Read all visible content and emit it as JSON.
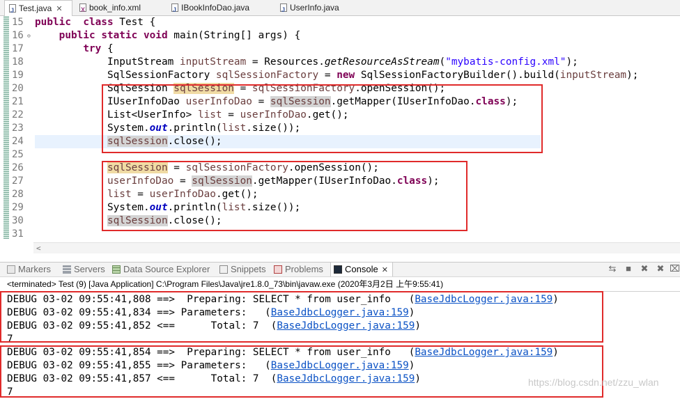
{
  "tabs": [
    {
      "label": "Test.java",
      "icon": "java-file-icon",
      "active": true,
      "close": "✕"
    },
    {
      "label": "book_info.xml",
      "icon": "xml-file-icon",
      "active": false
    },
    {
      "label": "IBookInfoDao.java",
      "icon": "java-file-icon",
      "active": false
    },
    {
      "label": "UserInfo.java",
      "icon": "java-file-icon",
      "active": false
    }
  ],
  "editor": {
    "line_numbers": [
      "15",
      "16",
      "17",
      "18",
      "19",
      "20",
      "21",
      "22",
      "23",
      "24",
      "25",
      "26",
      "27",
      "28",
      "29",
      "30",
      "31"
    ],
    "current_line": "24",
    "folds": {
      "16": "⊖"
    },
    "line_tokens": {
      "15": [
        [
          "kw",
          "public"
        ],
        [
          "",
          "  "
        ],
        [
          "kw",
          "class"
        ],
        [
          "",
          " Test {"
        ]
      ],
      "16": [
        [
          "",
          "    "
        ],
        [
          "kw",
          "public"
        ],
        [
          "",
          " "
        ],
        [
          "kw",
          "static"
        ],
        [
          "",
          " "
        ],
        [
          "kw",
          "void"
        ],
        [
          "",
          " main(String[] args) {"
        ]
      ],
      "17": [
        [
          "",
          "        "
        ],
        [
          "kw",
          "try"
        ],
        [
          "",
          " {"
        ]
      ],
      "18": [
        [
          "",
          "            InputStream "
        ],
        [
          "var",
          "inputStream"
        ],
        [
          "",
          " = Resources."
        ],
        [
          "sm",
          "getResourceAsStream"
        ],
        [
          "",
          "("
        ],
        [
          "str",
          "\"mybatis-config.xml\""
        ],
        [
          "",
          ");"
        ]
      ],
      "19": [
        [
          "",
          "            SqlSessionFactory "
        ],
        [
          "var",
          "sqlSessionFactory"
        ],
        [
          "",
          " = "
        ],
        [
          "kw",
          "new"
        ],
        [
          "",
          " SqlSessionFactoryBuilder().build("
        ],
        [
          "var",
          "inputStream"
        ],
        [
          "",
          ");"
        ]
      ],
      "20": [
        [
          "",
          "            SqlSession "
        ],
        [
          "var hl",
          "sqlSession"
        ],
        [
          "",
          " = "
        ],
        [
          "var",
          "sqlSessionFactory"
        ],
        [
          "",
          ".openSession();"
        ]
      ],
      "21": [
        [
          "",
          "            IUserInfoDao "
        ],
        [
          "var",
          "userInfoDao"
        ],
        [
          "",
          " = "
        ],
        [
          "var hlg",
          "sqlSession"
        ],
        [
          "",
          ".getMapper(IUserInfoDao."
        ],
        [
          "kw",
          "class"
        ],
        [
          "",
          ");"
        ]
      ],
      "22": [
        [
          "",
          "            List<UserInfo> "
        ],
        [
          "var",
          "list"
        ],
        [
          "",
          " = "
        ],
        [
          "var",
          "userInfoDao"
        ],
        [
          "",
          ".get();"
        ]
      ],
      "23": [
        [
          "",
          "            System."
        ],
        [
          "fld",
          "out"
        ],
        [
          "",
          ".println("
        ],
        [
          "var",
          "list"
        ],
        [
          "",
          ".size());"
        ]
      ],
      "24": [
        [
          "",
          "            "
        ],
        [
          "var hlg",
          "sqlSession"
        ],
        [
          "",
          ".close();"
        ]
      ],
      "25": [
        [
          "",
          ""
        ]
      ],
      "26": [
        [
          "",
          "            "
        ],
        [
          "var hl",
          "sqlSession"
        ],
        [
          "",
          " = "
        ],
        [
          "var",
          "sqlSessionFactory"
        ],
        [
          "",
          ".openSession();"
        ]
      ],
      "27": [
        [
          "",
          "            "
        ],
        [
          "var",
          "userInfoDao"
        ],
        [
          "",
          " = "
        ],
        [
          "var hlg",
          "sqlSession"
        ],
        [
          "",
          ".getMapper(IUserInfoDao."
        ],
        [
          "kw",
          "class"
        ],
        [
          "",
          ");"
        ]
      ],
      "28": [
        [
          "",
          "            "
        ],
        [
          "var",
          "list"
        ],
        [
          "",
          " = "
        ],
        [
          "var",
          "userInfoDao"
        ],
        [
          "",
          ".get();"
        ]
      ],
      "29": [
        [
          "",
          "            System."
        ],
        [
          "fld",
          "out"
        ],
        [
          "",
          ".println("
        ],
        [
          "var",
          "list"
        ],
        [
          "",
          ".size());"
        ]
      ],
      "30": [
        [
          "",
          "            "
        ],
        [
          "var hlg",
          "sqlSession"
        ],
        [
          "",
          ".close();"
        ]
      ],
      "31": [
        [
          "",
          ""
        ]
      ]
    },
    "scroll_arrow": "<"
  },
  "views": {
    "tabs": [
      {
        "label": "Markers",
        "icon": "markers-icon",
        "active": false
      },
      {
        "label": "Servers",
        "icon": "servers-icon",
        "active": false
      },
      {
        "label": "Data Source Explorer",
        "icon": "data-source-explorer-icon",
        "active": false
      },
      {
        "label": "Snippets",
        "icon": "snippets-icon",
        "active": false
      },
      {
        "label": "Problems",
        "icon": "problems-icon",
        "active": false
      },
      {
        "label": "Console",
        "icon": "console-icon",
        "active": true
      }
    ],
    "console_close": "✕",
    "toolbar_icons": [
      {
        "name": "link-icon",
        "glyph": "⇆"
      },
      {
        "name": "terminate-icon",
        "glyph": "■"
      },
      {
        "name": "remove-launch-icon",
        "glyph": "✖"
      },
      {
        "name": "remove-all-terminated-icon",
        "glyph": "✖"
      },
      {
        "name": "clear-console-icon",
        "glyph": "⌧"
      }
    ]
  },
  "console": {
    "status": "<terminated> Test (9) [Java Application] C:\\Program Files\\Java\\jre1.8.0_73\\bin\\javaw.exe (2020年3月2日 上午9:55:41)",
    "lines": [
      {
        "text": "DEBUG 03-02 09:55:41,808 ==>  Preparing: SELECT * from user_info   (",
        "link": "BaseJdbcLogger.java:159",
        "tail": ")"
      },
      {
        "text": "DEBUG 03-02 09:55:41,834 ==> Parameters:   (",
        "link": "BaseJdbcLogger.java:159",
        "tail": ")"
      },
      {
        "text": "DEBUG 03-02 09:55:41,852 <==      Total: 7  (",
        "link": "BaseJdbcLogger.java:159",
        "tail": ")"
      },
      {
        "text": "7",
        "link": "",
        "tail": ""
      },
      {
        "text": "DEBUG 03-02 09:55:41,854 ==>  Preparing: SELECT * from user_info   (",
        "link": "BaseJdbcLogger.java:159",
        "tail": ")"
      },
      {
        "text": "DEBUG 03-02 09:55:41,855 ==> Parameters:   (",
        "link": "BaseJdbcLogger.java:159",
        "tail": ")"
      },
      {
        "text": "DEBUG 03-02 09:55:41,857 <==      Total: 7  (",
        "link": "BaseJdbcLogger.java:159",
        "tail": ")"
      },
      {
        "text": "7",
        "link": "",
        "tail": ""
      }
    ]
  },
  "watermark": "https://blog.csdn.net/zzu_wlan",
  "colors": {
    "highlight_box": "#e02a2a",
    "keyword": "#7f0055",
    "string": "#2a00ff",
    "link": "#0b52c5"
  }
}
